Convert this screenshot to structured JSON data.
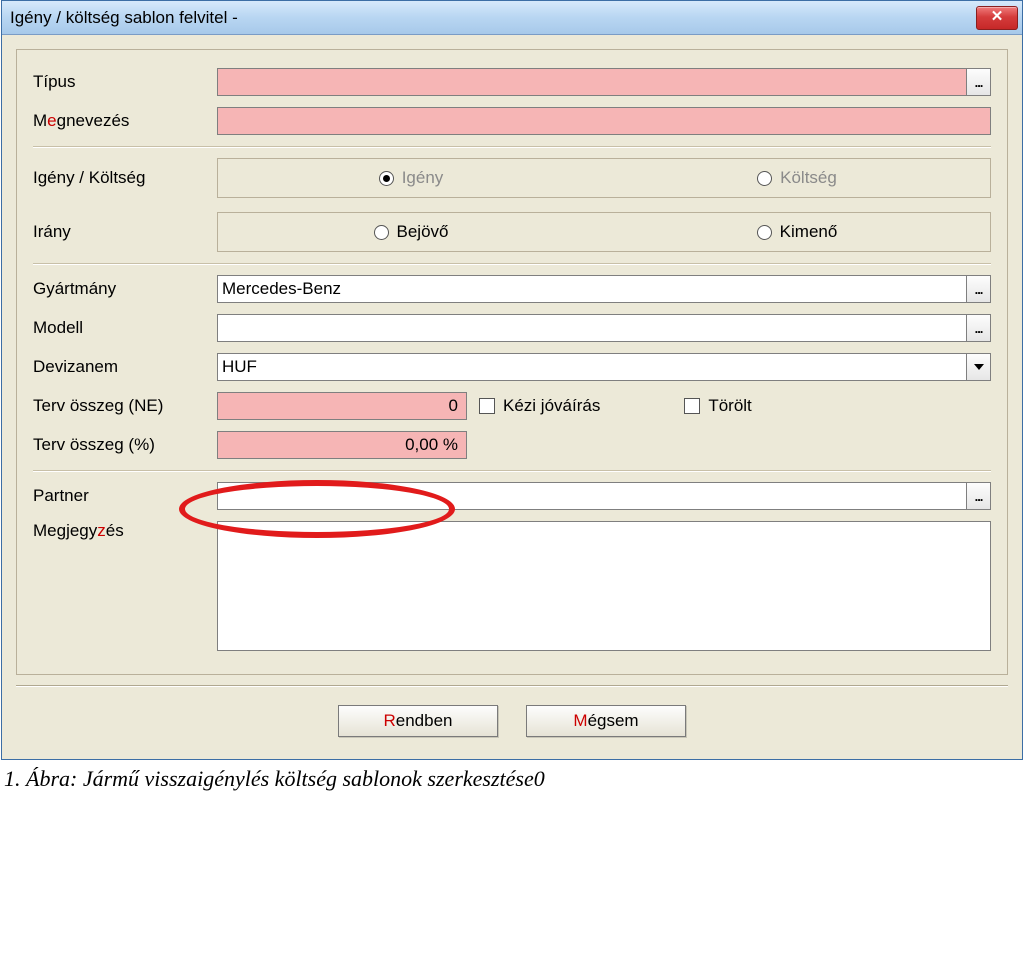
{
  "window": {
    "title": "Igény / költség sablon felvitel -",
    "close_glyph": "✕"
  },
  "labels": {
    "tipus": "Típus",
    "megnevezes_pre": "M",
    "megnevezes_hot": "e",
    "megnevezes_post": "gnevezés",
    "igeny_koltseg": "Igény / Költség",
    "irany": "Irány",
    "gyartmany": "Gyártmány",
    "modell": "Modell",
    "devizanem": "Devizanem",
    "terv_ne": "Terv összeg (NE)",
    "terv_pct": "Terv összeg (%)",
    "partner": "Partner",
    "megjegyzes_pre": "Megjegy",
    "megjegyzes_hot": "z",
    "megjegyzes_post": "és"
  },
  "radios": {
    "igeny": "Igény",
    "koltseg": "Költség",
    "bejovo": "Bejövő",
    "kimeno": "Kimenő"
  },
  "values": {
    "tipus": "",
    "megnevezes": "",
    "gyartmany": "Mercedes-Benz",
    "modell": "",
    "devizanem": "HUF",
    "terv_ne": "0",
    "terv_pct": "0,00 %",
    "partner": "",
    "megjegyzes": ""
  },
  "checks": {
    "kezi": "Kézi jóváírás",
    "torolt": "Törölt"
  },
  "buttons": {
    "ok_hot": "R",
    "ok_rest": "endben",
    "cancel_hot": "M",
    "cancel_rest": "égsem",
    "ellipsis": "..."
  },
  "caption": "1. Ábra: Jármű visszaigénylés költség sablonok szerkesztése0"
}
